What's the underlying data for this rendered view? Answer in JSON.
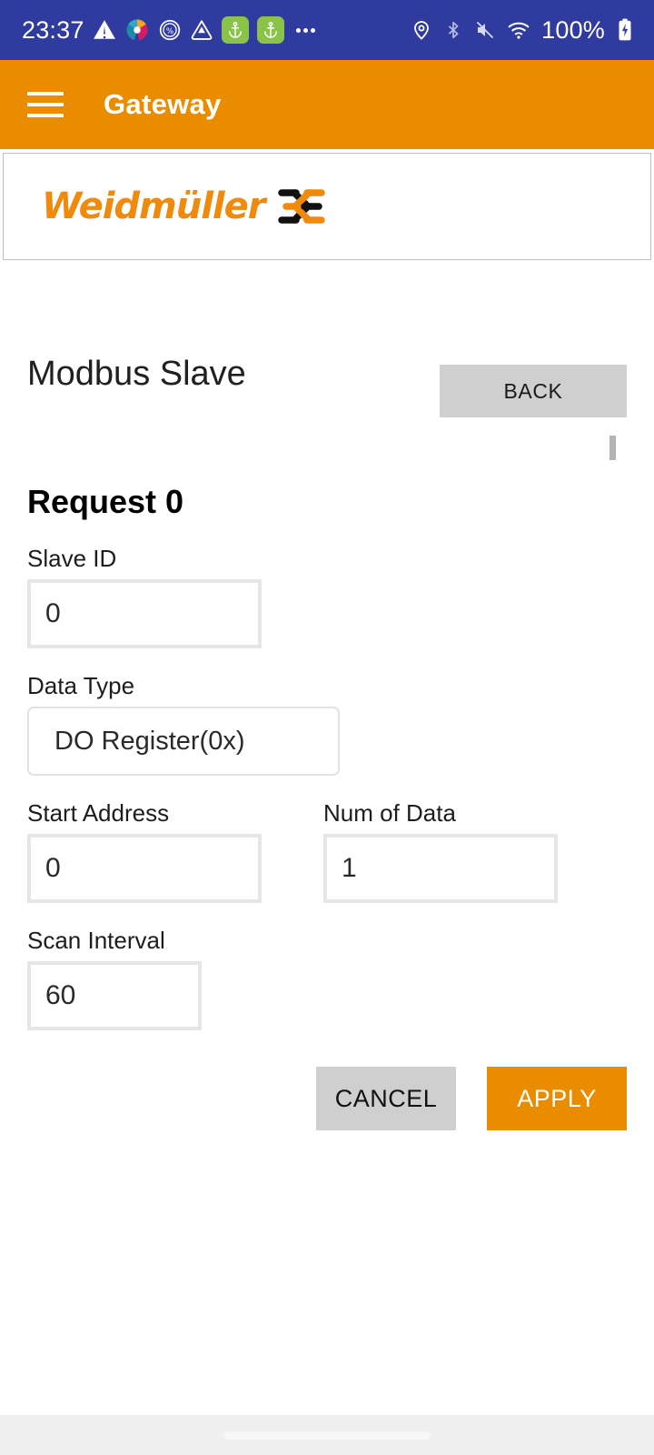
{
  "status_bar": {
    "time": "23:37",
    "battery_percent": "100%",
    "left_icons": [
      {
        "name": "warning-triangle-icon"
      },
      {
        "name": "app-logo-circle-icon"
      },
      {
        "name": "percent-circle-icon"
      },
      {
        "name": "triangle-shield-icon"
      },
      {
        "name": "anchor-badge-icon"
      },
      {
        "name": "anchor-badge-icon"
      },
      {
        "name": "more-dots-icon"
      }
    ],
    "right_icons": [
      {
        "name": "location-pin-icon"
      },
      {
        "name": "bluetooth-icon"
      },
      {
        "name": "volume-muted-icon"
      },
      {
        "name": "wifi-icon"
      },
      {
        "name": "battery-charging-icon"
      }
    ],
    "background_color": "#303BA0"
  },
  "app_bar": {
    "menu_icon": "hamburger-menu-icon",
    "title": "Gateway",
    "background_color": "#E98C00"
  },
  "brand": {
    "name": "Weidmüller",
    "mark_icon": "weidmuller-mark-icon",
    "orange": "#F08A0C",
    "black": "#111111"
  },
  "page": {
    "title": "Modbus Slave",
    "back_label": "BACK",
    "section_title": "Request 0"
  },
  "form": {
    "slave_id": {
      "label": "Slave ID",
      "value": "0",
      "placeholder": "0"
    },
    "data_type": {
      "label": "Data Type",
      "value": "DO Register(0x)",
      "options": [
        "DO Register(0x)"
      ]
    },
    "start_address": {
      "label": "Start Address",
      "value": "0",
      "placeholder": "0"
    },
    "num_of_data": {
      "label": "Num of Data",
      "value": "1",
      "placeholder": "1"
    },
    "scan_interval": {
      "label": "Scan Interval",
      "value": "60",
      "placeholder": "60"
    }
  },
  "actions": {
    "cancel_label": "CANCEL",
    "apply_label": "APPLY",
    "cancel_color": "#CFCFCF",
    "apply_color": "#E98C00"
  }
}
